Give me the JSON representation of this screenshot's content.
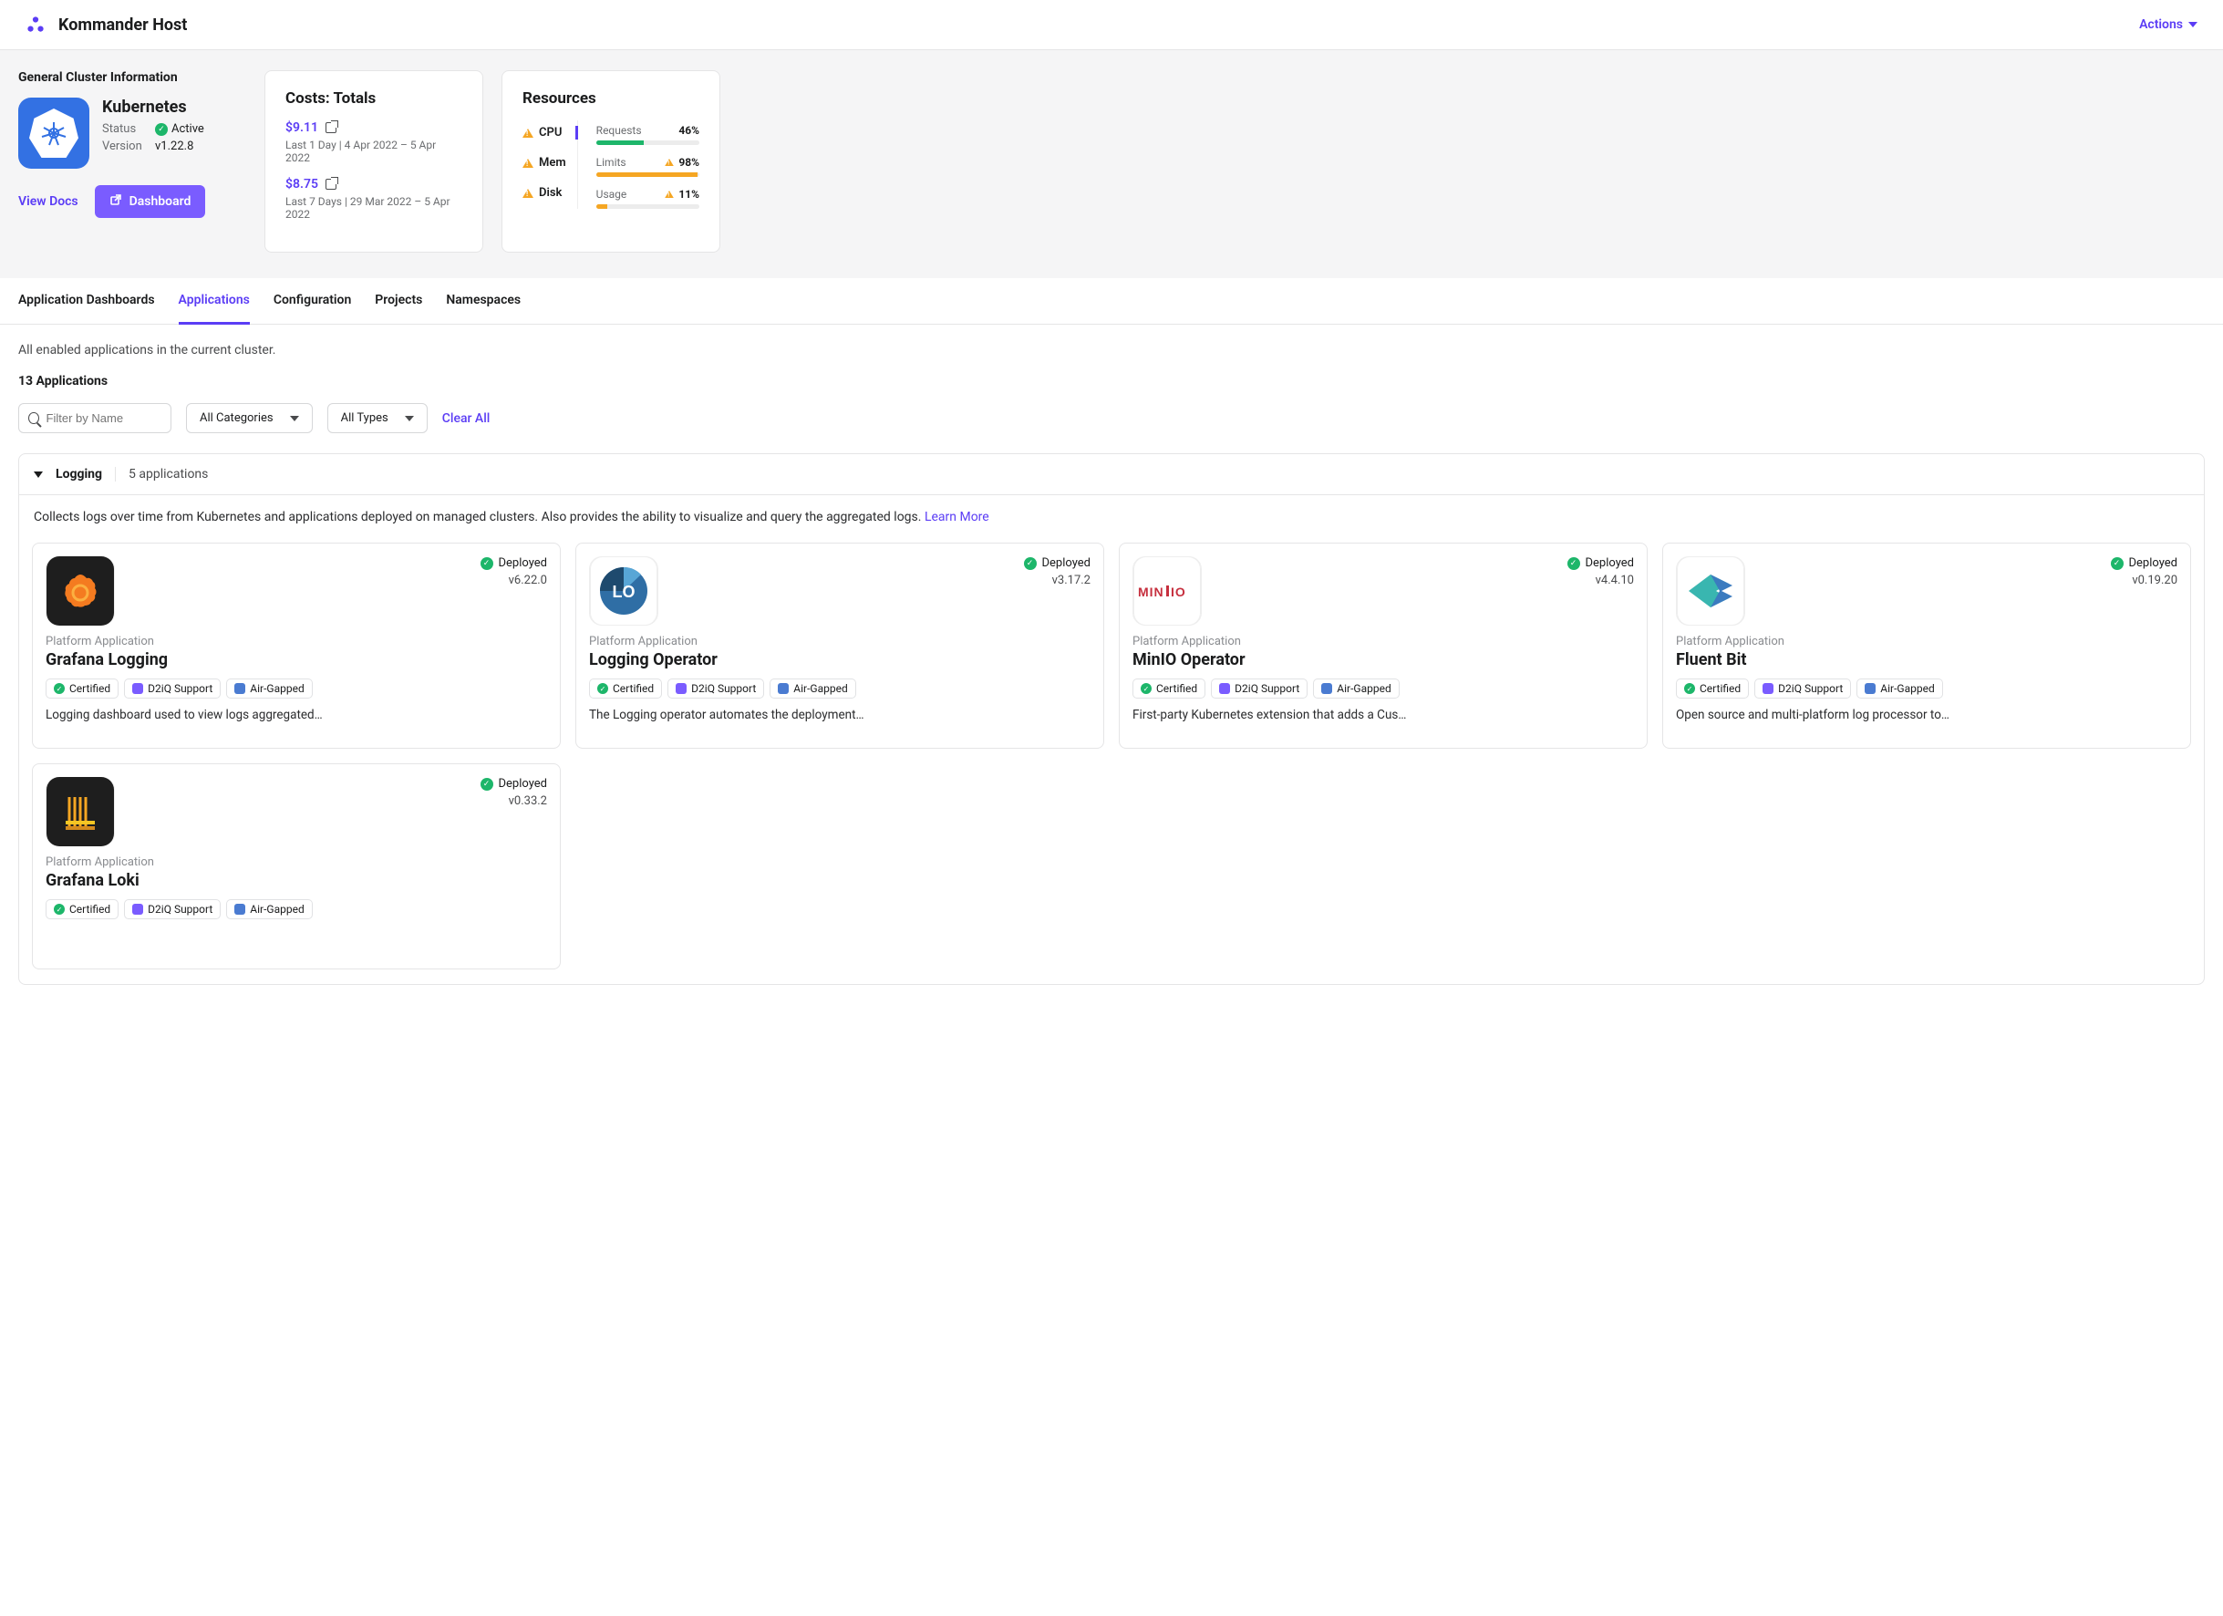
{
  "header": {
    "title": "Kommander Host",
    "actions_label": "Actions"
  },
  "general": {
    "section_title": "General Cluster Information",
    "name": "Kubernetes",
    "status_label": "Status",
    "status_value": "Active",
    "version_label": "Version",
    "version_value": "v1.22.8",
    "view_docs": "View Docs",
    "dashboard_btn": "Dashboard"
  },
  "costs": {
    "title": "Costs: Totals",
    "items": [
      {
        "value": "$9.11",
        "sub": "Last 1 Day | 4 Apr 2022 – 5 Apr 2022"
      },
      {
        "value": "$8.75",
        "sub": "Last 7 Days | 29 Mar 2022 – 5 Apr 2022"
      }
    ]
  },
  "resources": {
    "title": "Resources",
    "left": [
      {
        "label": "CPU",
        "active": true
      },
      {
        "label": "Mem",
        "active": false
      },
      {
        "label": "Disk",
        "active": false
      }
    ],
    "metrics": [
      {
        "label": "Requests",
        "value": "46%",
        "warn": false,
        "pct": 46,
        "color": "#1db66a"
      },
      {
        "label": "Limits",
        "value": "98%",
        "warn": true,
        "pct": 98,
        "color": "#f5a623"
      },
      {
        "label": "Usage",
        "value": "11%",
        "warn": true,
        "pct": 11,
        "color": "#f5a623"
      }
    ]
  },
  "tabs": [
    "Application Dashboards",
    "Applications",
    "Configuration",
    "Projects",
    "Namespaces"
  ],
  "active_tab": "Applications",
  "listing": {
    "description": "All enabled applications in the current cluster.",
    "count_label": "13 Applications",
    "filter_placeholder": "Filter by Name",
    "category_label": "All Categories",
    "type_label": "All Types",
    "clear_label": "Clear All"
  },
  "group": {
    "name": "Logging",
    "count": "5 applications",
    "description": "Collects logs over time from Kubernetes and applications deployed on managed clusters. Also provides the ability to visualize and query the aggregated logs. ",
    "learn_more": "Learn More"
  },
  "badges": {
    "certified": "Certified",
    "support": "D2iQ Support",
    "airgapped": "Air-Gapped"
  },
  "apps": [
    {
      "name": "Grafana Logging",
      "type": "Platform Application",
      "status": "Deployed",
      "version": "v6.22.0",
      "desc": "Logging dashboard used to view logs aggregated…",
      "icon": "grafana"
    },
    {
      "name": "Logging Operator",
      "type": "Platform Application",
      "status": "Deployed",
      "version": "v3.17.2",
      "desc": "The Logging operator automates the deployment…",
      "icon": "logging-operator"
    },
    {
      "name": "MinIO Operator",
      "type": "Platform Application",
      "status": "Deployed",
      "version": "v4.4.10",
      "desc": "First-party Kubernetes extension that adds a Cus…",
      "icon": "minio"
    },
    {
      "name": "Fluent Bit",
      "type": "Platform Application",
      "status": "Deployed",
      "version": "v0.19.20",
      "desc": "Open source and multi-platform log processor to…",
      "icon": "fluentbit"
    },
    {
      "name": "Grafana Loki",
      "type": "Platform Application",
      "status": "Deployed",
      "version": "v0.33.2",
      "desc": "",
      "icon": "loki"
    }
  ]
}
